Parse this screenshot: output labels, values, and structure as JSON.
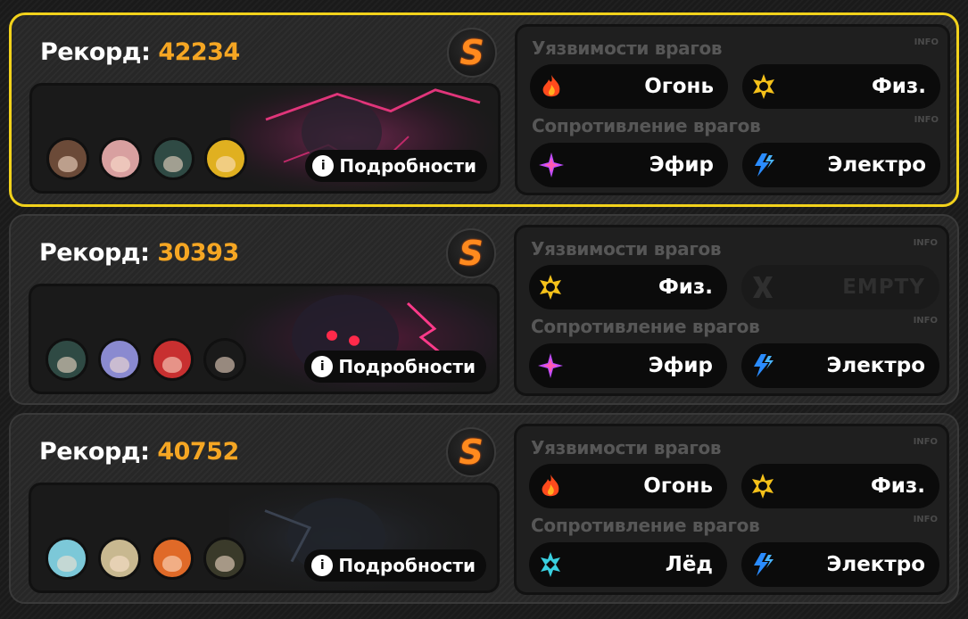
{
  "labels": {
    "record": "Рекорд:",
    "weakness": "Уязвимости врагов",
    "resistance": "Сопротивление врагов",
    "info": "INFO",
    "details": "Подробности"
  },
  "colors": {
    "selected_border": "#f2d21b",
    "score": "#f5a623",
    "rank": "#ff8a1e"
  },
  "records": [
    {
      "score": "42234",
      "rank": "S",
      "selected": true,
      "avatars": [
        "avatar-brown-hair",
        "avatar-pink-hair",
        "avatar-dark-hair",
        "avatar-yellow-hood"
      ],
      "weaknesses": [
        {
          "name": "Огонь",
          "icon": "fire-icon"
        },
        {
          "name": "Физ.",
          "icon": "physical-icon"
        }
      ],
      "resistances": [
        {
          "name": "Эфир",
          "icon": "ether-icon"
        },
        {
          "name": "Электро",
          "icon": "electric-icon"
        }
      ]
    },
    {
      "score": "30393",
      "rank": "S",
      "selected": false,
      "avatars": [
        "avatar-dark-hair",
        "avatar-lavender-hair",
        "avatar-red-hair",
        "avatar-black-robot"
      ],
      "weaknesses": [
        {
          "name": "Физ.",
          "icon": "physical-icon"
        },
        {
          "name": "EMPTY",
          "icon": "empty-x-icon"
        }
      ],
      "resistances": [
        {
          "name": "Эфир",
          "icon": "ether-icon"
        },
        {
          "name": "Электро",
          "icon": "electric-icon"
        }
      ]
    },
    {
      "score": "40752",
      "rank": "S",
      "selected": false,
      "avatars": [
        "avatar-cyan-hair",
        "avatar-blonde-eyepatch",
        "avatar-orange-hair",
        "avatar-green-robot"
      ],
      "weaknesses": [
        {
          "name": "Огонь",
          "icon": "fire-icon"
        },
        {
          "name": "Физ.",
          "icon": "physical-icon"
        }
      ],
      "resistances": [
        {
          "name": "Лёд",
          "icon": "ice-icon"
        },
        {
          "name": "Электро",
          "icon": "electric-icon"
        }
      ]
    }
  ]
}
